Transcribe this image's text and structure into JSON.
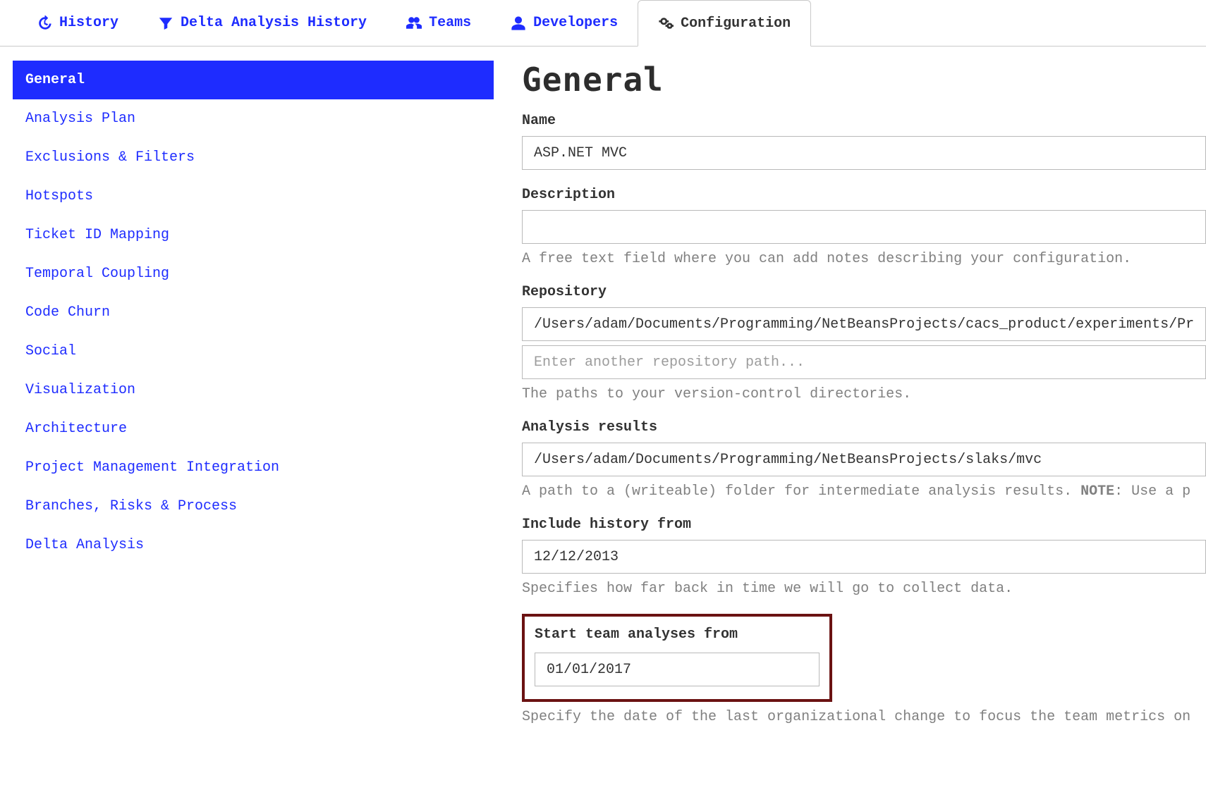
{
  "tabs": {
    "history": "History",
    "delta": "Delta Analysis History",
    "teams": "Teams",
    "developers": "Developers",
    "configuration": "Configuration"
  },
  "sidebar": [
    "General",
    "Analysis Plan",
    "Exclusions & Filters",
    "Hotspots",
    "Ticket ID Mapping",
    "Temporal Coupling",
    "Code Churn",
    "Social",
    "Visualization",
    "Architecture",
    "Project Management Integration",
    "Branches, Risks & Process",
    "Delta Analysis"
  ],
  "main": {
    "heading": "General",
    "name_label": "Name",
    "name_value": "ASP.NET MVC",
    "description_label": "Description",
    "description_value": "",
    "description_help": "A free text field where you can add notes describing your configuration.",
    "repository_label": "Repository",
    "repository_value": "/Users/adam/Documents/Programming/NetBeansProjects/cacs_product/experiments/Pr",
    "repository_placeholder": "Enter another repository path...",
    "repository_help": "The paths to your version-control directories.",
    "results_label": "Analysis results",
    "results_value": "/Users/adam/Documents/Programming/NetBeansProjects/slaks/mvc",
    "results_help_pre": "A path to a (writeable) folder for intermediate analysis results. ",
    "results_help_note": "NOTE",
    "results_help_post": ": Use a p",
    "history_label": "Include history from",
    "history_value": "12/12/2013",
    "history_help": "Specifies how far back in time we will go to collect data.",
    "team_label": "Start team analyses from",
    "team_value": "01/01/2017",
    "team_help": "Specify the date of the last organizational change to focus the team metrics on"
  }
}
